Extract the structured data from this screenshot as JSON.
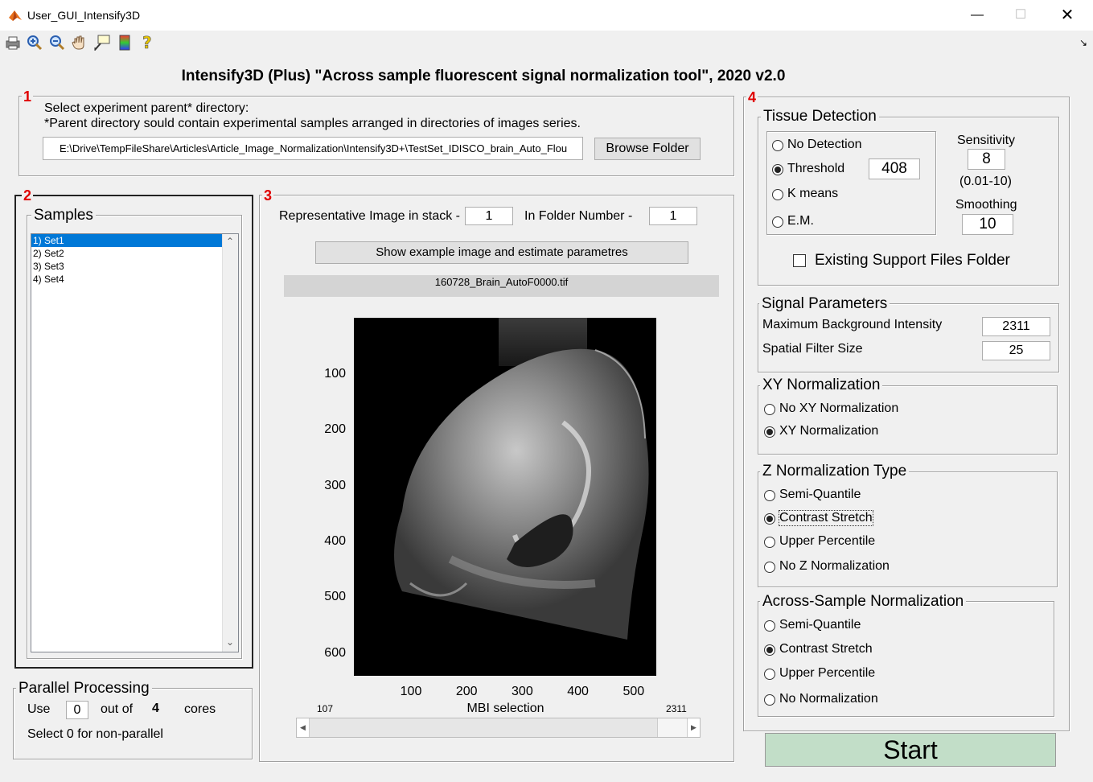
{
  "window": {
    "title": "User_GUI_Intensify3D"
  },
  "toolbar": {
    "icons": [
      "printer-icon",
      "zoom-in-icon",
      "zoom-out-icon",
      "pan-hand-icon",
      "data-cursor-icon",
      "colorbar-icon",
      "help-icon"
    ]
  },
  "header": {
    "title": "Intensify3D (Plus)  \"Across sample fluorescent signal normalization tool\",  2020 v2.0"
  },
  "section1": {
    "number": "1",
    "line1": "Select experiment parent* directory:",
    "line2": "*Parent directory sould contain experimental samples arranged in directories of images series.",
    "path": "E:\\Drive\\TempFileShare\\Articles\\Article_Image_Normalization\\Intensify3D+\\TestSet_IDISCO_brain_Auto_Flou",
    "browse_label": "Browse Folder"
  },
  "section2": {
    "number": "2",
    "samples_title": "Samples",
    "samples": [
      "1) Set1",
      "2) Set2",
      "3) Set3",
      "4) Set4"
    ],
    "selected_index": 0
  },
  "parallel": {
    "title": "Parallel Processing",
    "use_label": "Use",
    "use_value": "0",
    "out_of_label": "out of",
    "cores_count": "4",
    "cores_label": "cores",
    "hint": "Select 0 for non-parallel"
  },
  "section3": {
    "number": "3",
    "rep_image_label": "Representative Image in stack -",
    "rep_image_value": "1",
    "folder_number_label": "In Folder Number -",
    "folder_number_value": "1",
    "show_button_label": "Show example image and estimate parametres",
    "file_name": "160728_Brain_AutoF0000.tif",
    "y_ticks": [
      "100",
      "200",
      "300",
      "400",
      "500",
      "600"
    ],
    "x_ticks": [
      "100",
      "200",
      "300",
      "400",
      "500"
    ],
    "slider_min": "107",
    "slider_max": "2311",
    "slider_label": "MBI selection",
    "slider_fraction": 1.0
  },
  "section4": {
    "number": "4",
    "tissue": {
      "title": "Tissue Detection",
      "options": [
        "No Detection",
        "Threshold",
        "K means",
        "E.M."
      ],
      "selected": "Threshold",
      "threshold_value": "408",
      "sensitivity_label": "Sensitivity",
      "sensitivity_value": "8",
      "sensitivity_range": "(0.01-10)",
      "smoothing_label": "Smoothing",
      "smoothing_value": "10",
      "existing_support_label": "Existing Support Files Folder",
      "existing_support_checked": false
    },
    "signal": {
      "title": "Signal Parameters",
      "max_bg_label": "Maximum Background Intensity",
      "max_bg_value": "2311",
      "spatial_label": "Spatial Filter Size",
      "spatial_value": "25"
    },
    "xy": {
      "title": "XY Normalization",
      "options": [
        "No XY Normalization",
        "XY Normalization"
      ],
      "selected": "XY Normalization"
    },
    "z": {
      "title": "Z Normalization Type",
      "options": [
        "Semi-Quantile",
        "Contrast Stretch",
        "Upper Percentile",
        "No Z Normalization"
      ],
      "selected": "Contrast Stretch"
    },
    "across": {
      "title": "Across-Sample Normalization",
      "options": [
        "Semi-Quantile",
        "Contrast Stretch",
        "Upper Percentile",
        "No Normalization"
      ],
      "selected": "Contrast Stretch"
    }
  },
  "start_button": {
    "label": "Start",
    "color": "#c2dec8"
  }
}
